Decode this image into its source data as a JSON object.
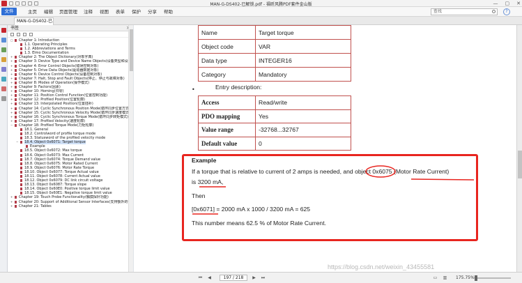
{
  "window": {
    "title": "MAN-G-DS402-已解锁.pdf - 福昕风腾PDF套件金山版",
    "controls": [
      "—",
      "▢",
      "✕"
    ]
  },
  "menu": {
    "file": "文件",
    "items": [
      "主页",
      "编辑",
      "页面管理",
      "注释",
      "视图",
      "表单",
      "保护",
      "分享",
      "帮助"
    ]
  },
  "search": {
    "placeholder": "查找"
  },
  "tab": {
    "label": "MAN-G-DS402-已..."
  },
  "panel": {
    "title": "书签"
  },
  "bookmarks": [
    {
      "label": "Chapter 1: Introduction",
      "level": 0,
      "twisty": "▢"
    },
    {
      "label": "1.1. Operating Principles",
      "level": 1
    },
    {
      "label": "1.2. Abbreviations and Terms",
      "level": 1
    },
    {
      "label": "1.3. Elmo Documentation",
      "level": 1
    },
    {
      "label": "Chapter 2: The Object Dictionary(对象字典)",
      "level": 0,
      "twisty": "+"
    },
    {
      "label": "Chapter 3: Device Type and Device Name Objects(设备类型和设备名称对象)",
      "level": 0,
      "twisty": "+"
    },
    {
      "label": "Chapter 4: Error Control Objects(错误控制对象)",
      "level": 0,
      "twisty": "+"
    },
    {
      "label": "Chapter 5: Drive Data Objects(驱动器数据对象)",
      "level": 0,
      "twisty": "+"
    },
    {
      "label": "Chapter 6: Device Control Objects(设备控制对象)",
      "level": 0,
      "twisty": "+"
    },
    {
      "label": "Chapter 7: Halt, Stop and Fault Objects(停止、停止与故障对象)",
      "level": 0,
      "twisty": "+"
    },
    {
      "label": "Chapter 8: Modes of Operation(操作模式)",
      "level": 0,
      "twisty": "+"
    },
    {
      "label": "Chapter 9: Factors(因素)",
      "level": 0,
      "twisty": "+"
    },
    {
      "label": "Chapter 10: Homing(归零)",
      "level": 0,
      "twisty": "+"
    },
    {
      "label": "Chapter 11: Position Control Function(位置控制功能)",
      "level": 0,
      "twisty": "+"
    },
    {
      "label": "Chapter 12: Profiled Position(位置轮廓)",
      "level": 0,
      "twisty": "+"
    },
    {
      "label": "Chapter 13: Interpolated Position(位置插补)",
      "level": 0,
      "twisty": "+"
    },
    {
      "label": "Chapter 14: Cyclic Synchronous Position Mode(循环同步位置方式)",
      "level": 0,
      "twisty": "+"
    },
    {
      "label": "Chapter 15: Cyclic Synchronous Velocity Mode(循环同步速度模式)",
      "level": 0,
      "twisty": "+"
    },
    {
      "label": "Chapter 16: Cyclic Synchronous Torque Mode(循环同步转矩模式)",
      "level": 0,
      "twisty": "+"
    },
    {
      "label": "Chapter 17: Profiled Velocity(速度轮廓)",
      "level": 0,
      "twisty": "+"
    },
    {
      "label": "Chapter 18: Profiled Torque Mode(力矩轮廓)",
      "level": 0,
      "twisty": "−"
    },
    {
      "label": "18.1. General",
      "level": 1
    },
    {
      "label": "18.2. Controlword of profile torque mode",
      "level": 1
    },
    {
      "label": "18.3. Statusword of the profiled velocity mode",
      "level": 1
    },
    {
      "label": "18.4. Object 0x6071: Target torque",
      "level": 1,
      "twisty": "−",
      "selected": true
    },
    {
      "label": "Example",
      "level": 2
    },
    {
      "label": "18.5. Object 0x6072: Max torque",
      "level": 1
    },
    {
      "label": "18.6. Object 0x6073: Max Current",
      "level": 1
    },
    {
      "label": "18.7. Object 0x6074: Torque Demand value",
      "level": 1
    },
    {
      "label": "18.8. Object 0x6075: Motor Rated Current",
      "level": 1
    },
    {
      "label": "18.9. Object 0x6076: Motor Rate Torque",
      "level": 1
    },
    {
      "label": "18.10. Object 0x6077: Torque Actual value",
      "level": 1
    },
    {
      "label": "18.11. Object 0x6078: Current Actual value",
      "level": 1
    },
    {
      "label": "18.12. Object 0x6079: DC link circuit voltage",
      "level": 1
    },
    {
      "label": "18.13. Object 0x6087: Torque slope",
      "level": 1
    },
    {
      "label": "18.14. Object 0x60E0: Positive torque limit value",
      "level": 1
    },
    {
      "label": "18.15. Object 0x60E1: Negative torque limit value",
      "level": 1
    },
    {
      "label": "Chapter 19: Touch Probe Functionality(触摸探针功能)",
      "level": 0,
      "twisty": "+"
    },
    {
      "label": "Chapter 20: Support of Additional Sensor Interfaces(支持额外的传感器接口)",
      "level": 0,
      "twisty": "+"
    },
    {
      "label": "Chapter 21: Tables",
      "level": 0,
      "twisty": "+"
    }
  ],
  "doc": {
    "top_table": [
      [
        "Name",
        "Target torque"
      ],
      [
        "Object code",
        "VAR"
      ],
      [
        "Data type",
        "INTEGER16"
      ],
      [
        "Category",
        "Mandatory"
      ]
    ],
    "entry_label": "Entry description:",
    "bullet": "•",
    "bottom_table": [
      [
        "Access",
        "Read/write"
      ],
      [
        "PDO mapping",
        "Yes"
      ],
      [
        "Value range",
        "-32768...32767"
      ],
      [
        "Default value",
        "0"
      ]
    ],
    "example": {
      "title": "Example",
      "line1a": "If a torque that is relative to current of 2 amps is needed, and object 0x6075 (Motor Rate Current)",
      "line1b": "is 3200 mA,",
      "line2": "Then",
      "line3": "[0x6071] = 2000 mA x 1000 / 3200 mA  = 625",
      "line4": "This number means 62.5 % of Motor Rate Current."
    }
  },
  "watermark": "https://blog.csdn.net/weixin_43455581",
  "status": {
    "page": "197 / 218",
    "zoom": "175.75%"
  },
  "colors": {
    "accent": "#2f6fd6",
    "table_border": "#c0504d",
    "annotation_red": "#e8251f",
    "bookmark_icon": "#b23b48"
  }
}
